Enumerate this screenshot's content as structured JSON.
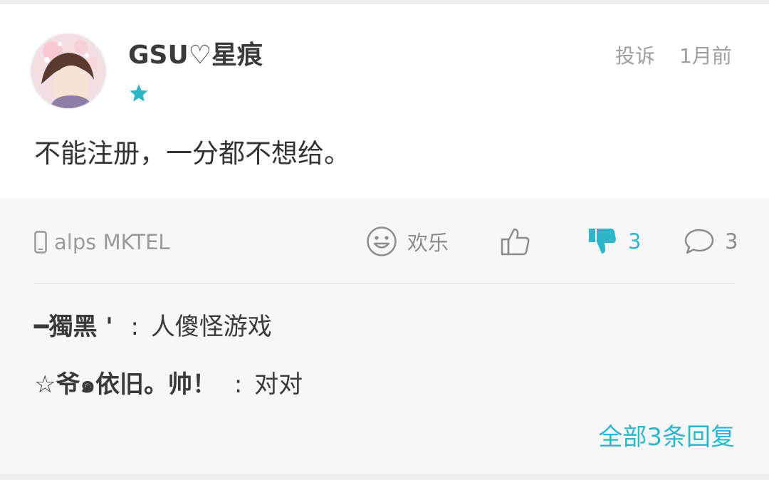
{
  "comment": {
    "username": "GSU♡星痕",
    "report_label": "投诉",
    "time": "1月前",
    "content": "不能注册，一分都不想给。",
    "device": "alps MKTEL",
    "mood_label": "欢乐",
    "dislike_count": "3",
    "reply_count": "3",
    "accent_color": "#2cb6c8"
  },
  "replies": [
    {
      "author": "━獨黑 '",
      "separator": ":",
      "text": "人傻怪游戏"
    },
    {
      "author": "☆爷๑依旧。帅！",
      "separator": ":",
      "text": "对对"
    }
  ],
  "all_replies_label": "全部3条回复",
  "icons": [
    "avatar",
    "star-icon",
    "phone-icon",
    "smiley-icon",
    "thumbs-up-icon",
    "thumbs-down-icon",
    "chat-bubble-icon"
  ]
}
